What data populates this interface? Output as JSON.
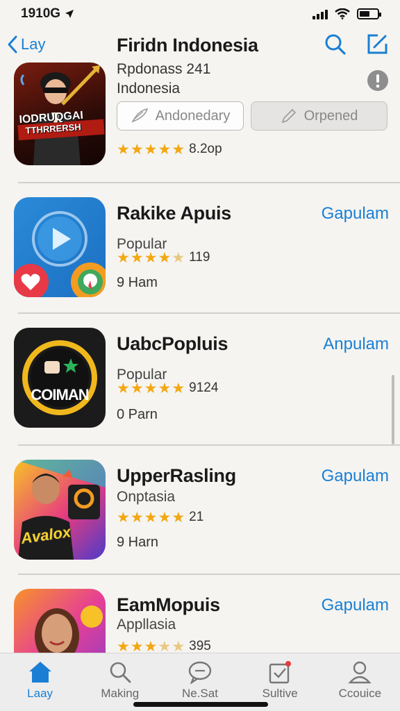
{
  "status_bar": {
    "time": "1910G"
  },
  "nav": {
    "back_label": "Lay",
    "title": "Firidn Indonesia"
  },
  "featured": {
    "subtitle_1": "Rpdonass 241",
    "subtitle_2": "Indonesia",
    "icon_text_1": "IODRUQGAI",
    "icon_text_2": "TTHRRERSH",
    "pill_1": "Andonedary",
    "pill_2": "Orpened",
    "stars": 5,
    "rating_text": "8.2op"
  },
  "apps": [
    {
      "name": "Rakike Apuis",
      "category": "Popular",
      "stars": 3.5,
      "rating_count": "119",
      "size": "9 Ham",
      "action": "Gapulam"
    },
    {
      "name": "UabcPopluis",
      "category": "Popular",
      "stars": 5,
      "rating_count": "9124",
      "size": "0 Parn",
      "action": "Anpulam",
      "icon_text": "COIMAN"
    },
    {
      "name": "UpperRasling",
      "category": "Onptasia",
      "stars": 4.5,
      "rating_count": "21",
      "size": "9 Harn",
      "action": "Gapulam",
      "icon_text": "Avalox"
    },
    {
      "name": "EamMopuis",
      "category": "Appllasia",
      "stars": 2.5,
      "rating_count": "395",
      "size": "",
      "action": "Gapulam"
    }
  ],
  "tabs": [
    {
      "label": "Laay",
      "icon": "home-icon",
      "active": true
    },
    {
      "label": "Making",
      "icon": "search-icon",
      "active": false
    },
    {
      "label": "Ne.Sat",
      "icon": "chat-bubble-icon",
      "active": false
    },
    {
      "label": "Sultive",
      "icon": "inbox-check-icon",
      "active": false
    },
    {
      "label": "Ccouice",
      "icon": "person-icon",
      "active": false
    }
  ],
  "colors": {
    "accent": "#1a7fd4",
    "star": "#f3a712"
  }
}
